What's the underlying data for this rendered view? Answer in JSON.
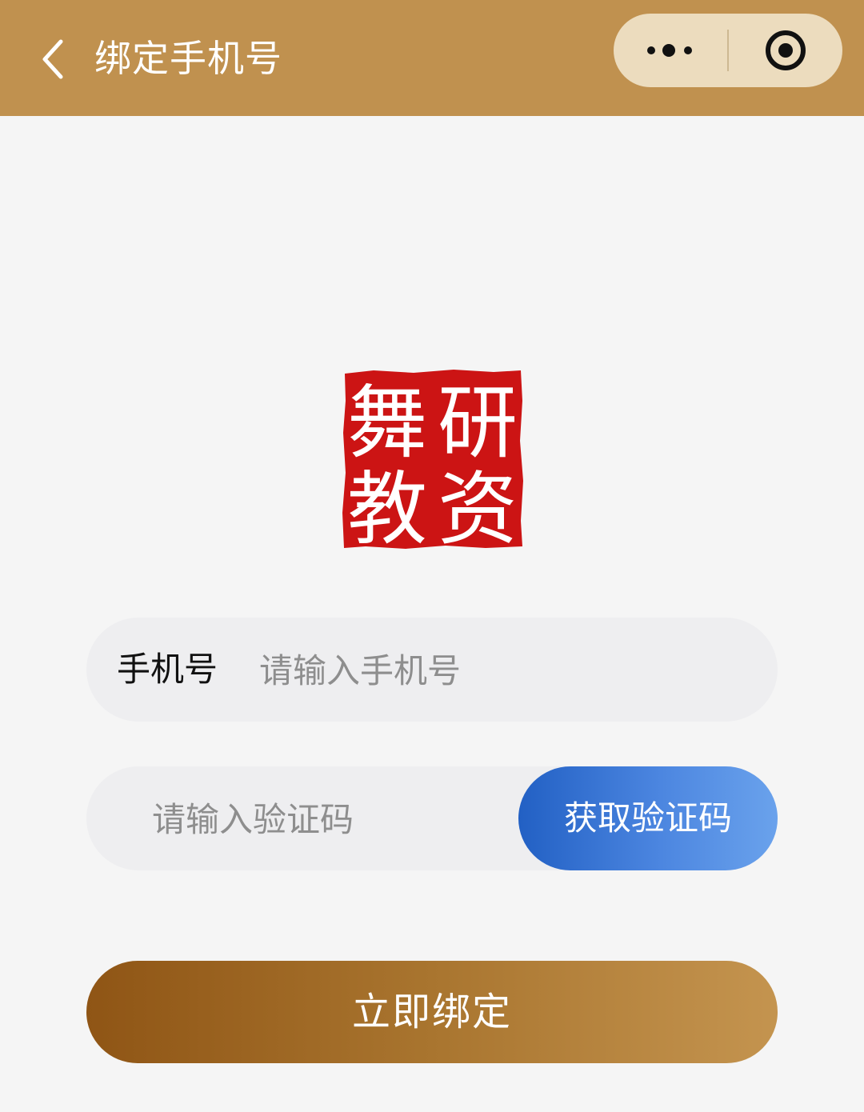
{
  "header": {
    "title": "绑定手机号",
    "back_icon": "chevron-left-icon",
    "more_icon": "more-dots-icon",
    "close_icon": "target-circle-icon",
    "background_color": "#c0914f",
    "capsule_color": "#ecdcbe"
  },
  "logo": {
    "characters": [
      "舞",
      "研",
      "教",
      "资"
    ],
    "seal_color": "#cc1414"
  },
  "form": {
    "phone_label": "手机号",
    "phone_placeholder": "请输入手机号",
    "code_placeholder": "请输入验证码",
    "get_code_label": "获取验证码",
    "code_button_color": "#2e6fd0"
  },
  "submit": {
    "label": "立即绑定",
    "color": "#a9752f"
  }
}
